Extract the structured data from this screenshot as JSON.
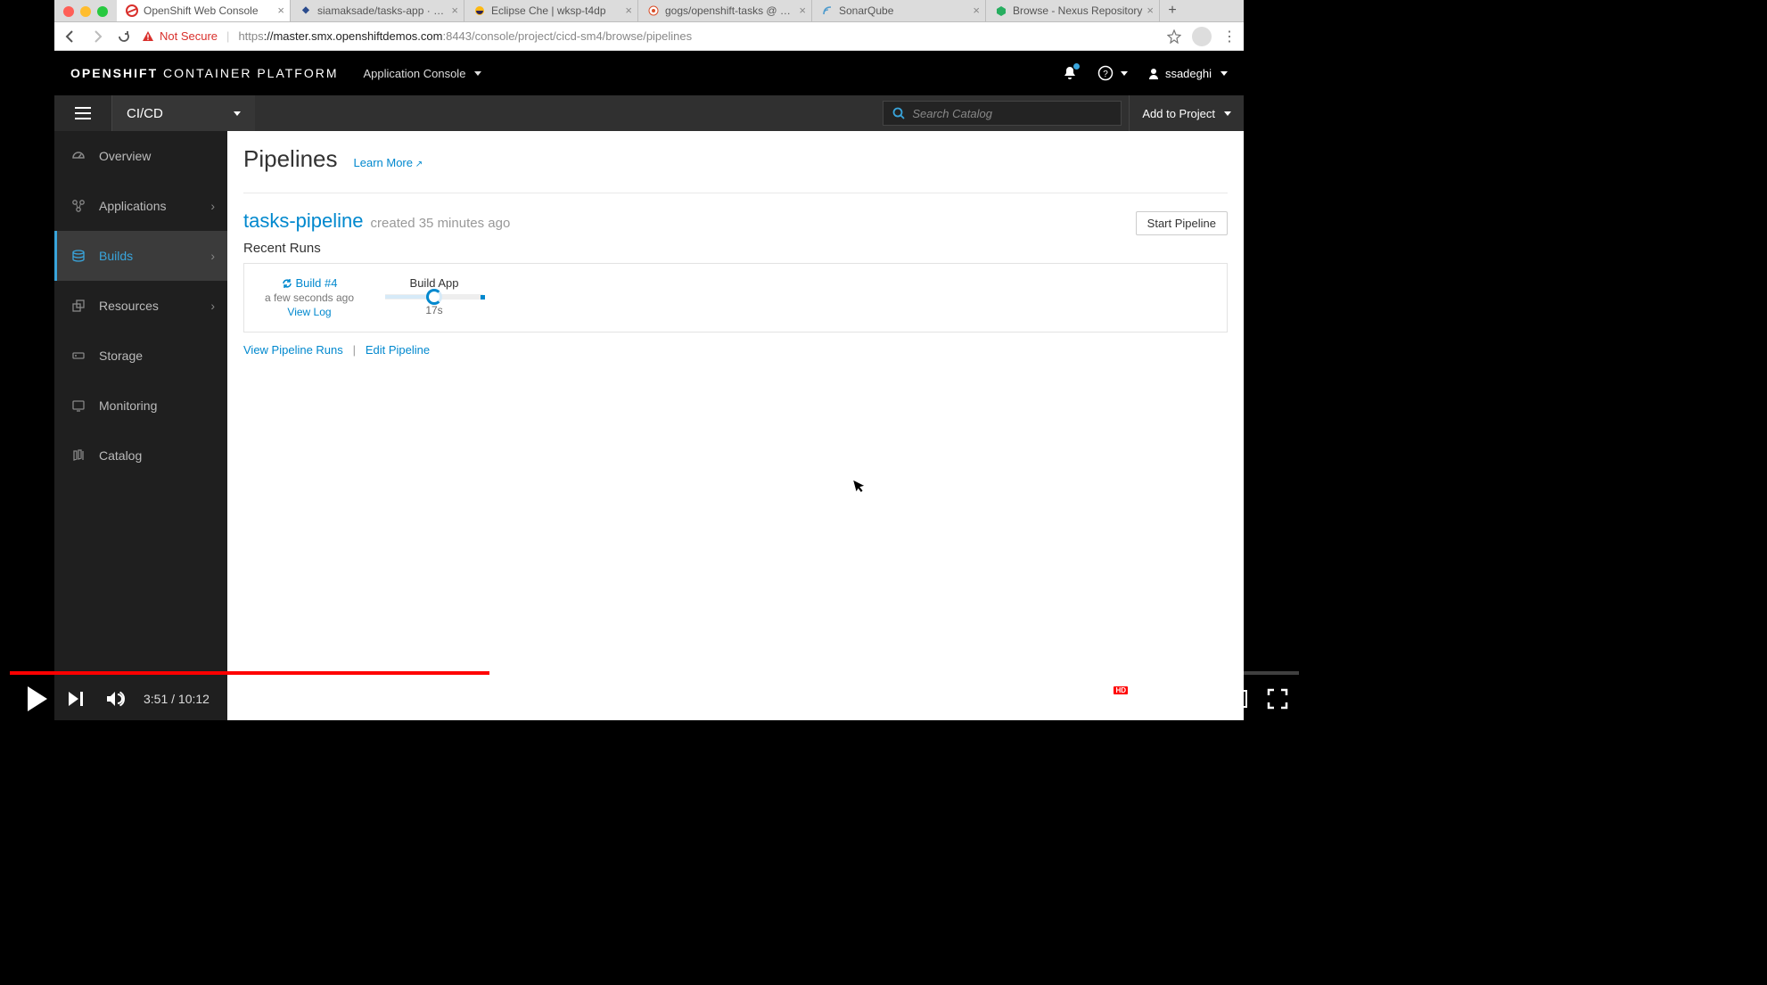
{
  "browser": {
    "tabs": [
      {
        "title": "OpenShift Web Console",
        "active": true
      },
      {
        "title": "siamaksade/tasks-app · Qua",
        "active": false
      },
      {
        "title": "Eclipse Che | wksp-t4dp",
        "active": false
      },
      {
        "title": "gogs/openshift-tasks @ eap",
        "active": false
      },
      {
        "title": "SonarQube",
        "active": false
      },
      {
        "title": "Browse - Nexus Repository",
        "active": false
      }
    ],
    "not_secure_label": "Not Secure",
    "url_scheme": "https",
    "url_host": "://master.smx.openshiftdemos.com",
    "url_path": ":8443/console/project/cicd-sm4/browse/pipelines"
  },
  "header": {
    "logo_bold": "OPENSHIFT",
    "logo_light": " CONTAINER PLATFORM",
    "app_console_label": "Application Console",
    "username": "ssadeghi"
  },
  "project_bar": {
    "project_name": "CI/CD",
    "search_placeholder": "Search Catalog",
    "add_to_project": "Add to Project"
  },
  "sidebar": {
    "items": [
      {
        "label": "Overview"
      },
      {
        "label": "Applications"
      },
      {
        "label": "Builds"
      },
      {
        "label": "Resources"
      },
      {
        "label": "Storage"
      },
      {
        "label": "Monitoring"
      },
      {
        "label": "Catalog"
      }
    ]
  },
  "main": {
    "page_title": "Pipelines",
    "learn_more": "Learn More",
    "pipeline_name": "tasks-pipeline",
    "pipeline_created": "created 35 minutes ago",
    "start_pipeline_btn": "Start Pipeline",
    "recent_runs_label": "Recent Runs",
    "build_link": "Build #4",
    "build_time": "a few seconds ago",
    "view_log": "View Log",
    "stage_name": "Build App",
    "stage_duration": "17s",
    "view_pipeline_runs": "View Pipeline Runs",
    "edit_pipeline": "Edit Pipeline",
    "link_separator": "|"
  },
  "video": {
    "current_time": "3:51",
    "duration": "10:12",
    "time_separator": " / ",
    "hd_badge": "HD"
  }
}
